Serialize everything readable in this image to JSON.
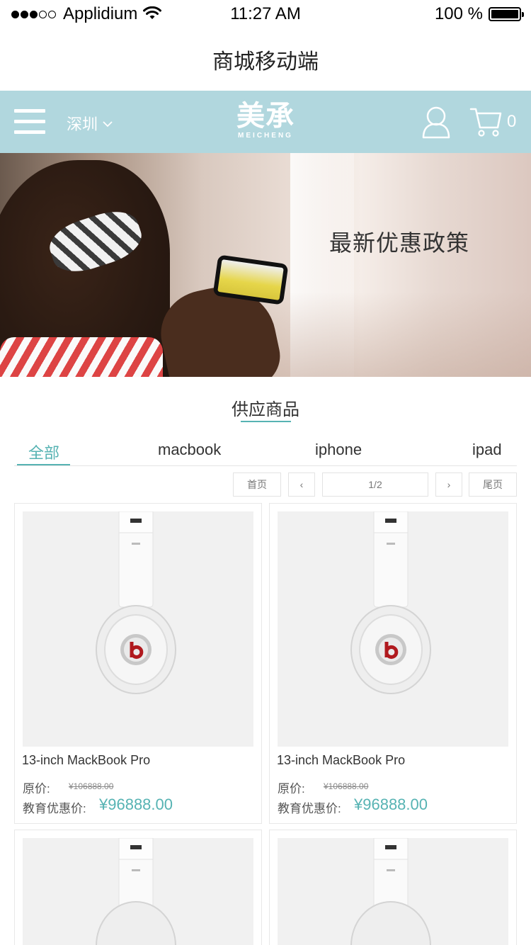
{
  "status_bar": {
    "carrier": "Applidium",
    "time": "11:27 AM",
    "battery": "100 %"
  },
  "title_bar": {
    "title": "商城移动端"
  },
  "header": {
    "city": "深圳",
    "logo_cn": "美承",
    "logo_en": "MEICHENG",
    "cart_count": "0",
    "background_color": "#b1d7de"
  },
  "banner": {
    "text": "最新优惠政策"
  },
  "section": {
    "title": "供应商品",
    "accent_color": "#56b3b3"
  },
  "tabs": [
    {
      "label": "全部",
      "active": true
    },
    {
      "label": "macbook",
      "active": false
    },
    {
      "label": "iphone",
      "active": false
    },
    {
      "label": "ipad",
      "active": false
    }
  ],
  "pager": {
    "first": "首页",
    "prev": "‹",
    "page": "1/2",
    "next": "›",
    "last": "尾页"
  },
  "products": [
    {
      "name": "13-inch MackBook Pro",
      "orig_label": "原价:",
      "orig_price": "¥106888.00",
      "edu_label": "教育优惠价:",
      "edu_price": "¥96888.00"
    },
    {
      "name": "13-inch MackBook Pro",
      "orig_label": "原价:",
      "orig_price": "¥106888.00",
      "edu_label": "教育优惠价:",
      "edu_price": "¥96888.00"
    },
    {
      "name": "",
      "orig_label": "",
      "orig_price": "",
      "edu_label": "",
      "edu_price": ""
    },
    {
      "name": "",
      "orig_label": "",
      "orig_price": "",
      "edu_label": "",
      "edu_price": ""
    }
  ]
}
